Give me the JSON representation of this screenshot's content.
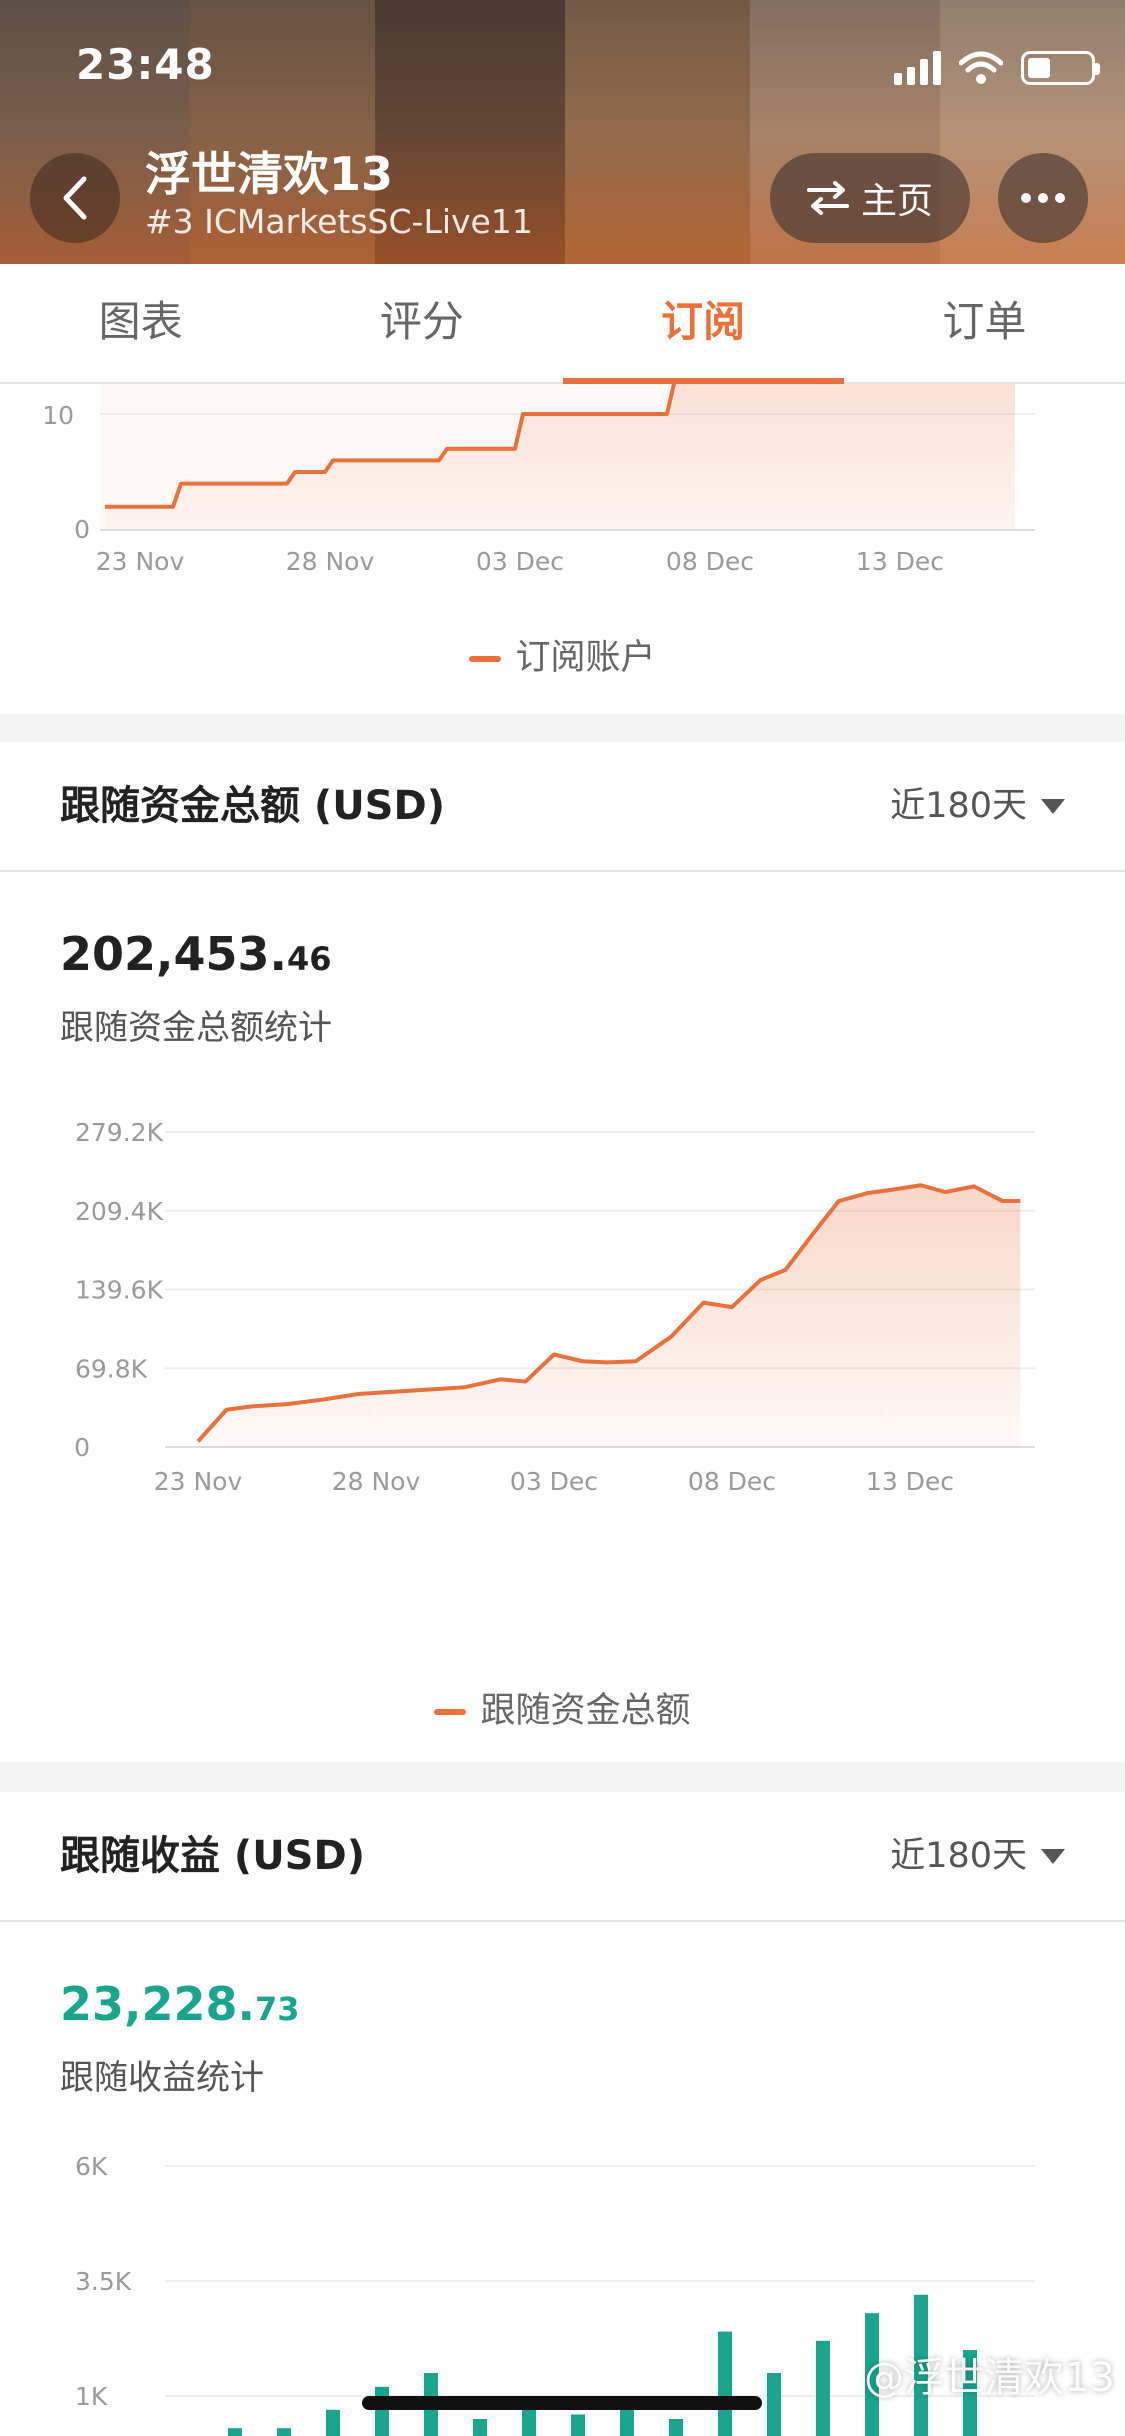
{
  "status_bar": {
    "time": "23:48"
  },
  "header": {
    "title": "浮世清欢13",
    "subtitle": "#3 ICMarketsSC-Live11",
    "home_label": "主页"
  },
  "tabs": [
    {
      "label": "图表",
      "active": false
    },
    {
      "label": "评分",
      "active": false
    },
    {
      "label": "订阅",
      "active": true
    },
    {
      "label": "订单",
      "active": false
    }
  ],
  "accent_color": "#e8713c",
  "positive_color": "#1aa68e",
  "subscription_chart": {
    "legend": "订阅账户",
    "chart_data": {
      "type": "area",
      "x_ticks": [
        "23 Nov",
        "28 Nov",
        "03 Dec",
        "08 Dec",
        "13 Dec"
      ],
      "y_ticks": [
        "0",
        "10"
      ],
      "series": [
        {
          "name": "订阅账户",
          "x": [
            "22 Nov",
            "23 Nov",
            "24 Nov",
            "25 Nov",
            "26 Nov",
            "27 Nov",
            "28 Nov",
            "29 Nov",
            "30 Nov",
            "01 Dec",
            "02 Dec",
            "03 Dec",
            "04 Dec",
            "05 Dec",
            "06 Dec",
            "07 Dec"
          ],
          "y": [
            2,
            2,
            4,
            4,
            4,
            5,
            6,
            6,
            6,
            7,
            7,
            10,
            10,
            10,
            10,
            13
          ]
        }
      ]
    }
  },
  "follow_funds": {
    "title": "跟随资金总额 (USD)",
    "range": "近180天",
    "total_int": "202,453.",
    "total_dec": "46",
    "stat_label": "跟随资金总额统计",
    "legend": "跟随资金总额",
    "chart_data": {
      "type": "area",
      "x_ticks": [
        "23 Nov",
        "28 Nov",
        "03 Dec",
        "08 Dec",
        "13 Dec"
      ],
      "y_ticks": [
        "0",
        "69.8K",
        "139.6K",
        "209.4K",
        "279.2K"
      ],
      "ylim": [
        0,
        279.2
      ],
      "series": [
        {
          "name": "跟随资金总额",
          "x_days": [
            0,
            0.8,
            1.5,
            2.5,
            3.5,
            4.5,
            5.5,
            6.5,
            7.5,
            8.5,
            9.2,
            10,
            10.8,
            11.5,
            12.3,
            13.3,
            14.2,
            15,
            15.8,
            16.5,
            17.3,
            18,
            18.8,
            19.5,
            20.3,
            21,
            21.8,
            22.6,
            23.1
          ],
          "y_k": [
            5,
            33,
            36,
            38,
            42,
            47,
            49,
            51,
            53,
            60,
            58,
            82,
            76,
            75,
            76,
            98,
            128,
            124,
            148,
            157,
            190,
            218,
            225,
            228,
            232,
            226,
            231,
            218,
            218
          ]
        }
      ]
    }
  },
  "follow_profit": {
    "title": "跟随收益 (USD)",
    "range": "近180天",
    "total_int": "23,228.",
    "total_dec": "73",
    "stat_label": "跟随收益统计",
    "chart_data": {
      "type": "bar",
      "y_ticks": [
        "1K",
        "3.5K",
        "6K"
      ],
      "values_k": [
        0.3,
        0.3,
        0.7,
        1.2,
        1.5,
        0.5,
        0.8,
        0.6,
        0.8,
        0.5,
        2.4,
        1.5,
        2.2,
        2.8,
        3.2,
        2.0
      ]
    }
  },
  "watermark": "@浮世清欢13"
}
